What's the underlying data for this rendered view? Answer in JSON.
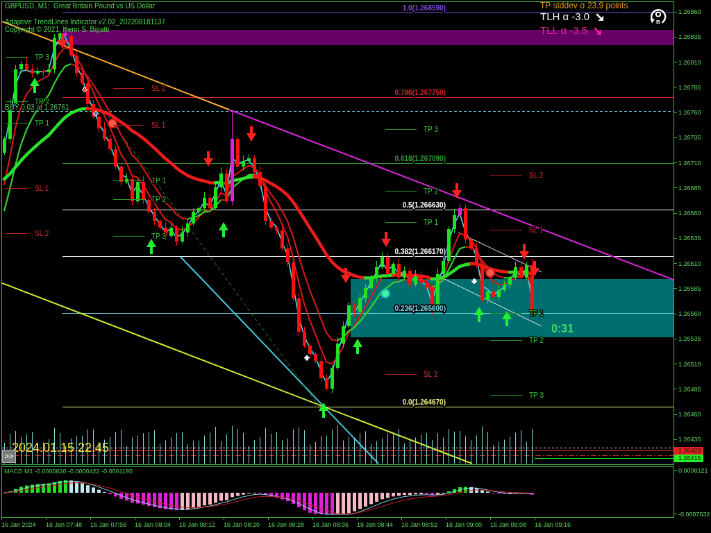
{
  "header": {
    "title": "GBPUSD, M1:  Great Britain Pound vs US Dollar",
    "indicator": "Adaptive TrendLines Indicator v2.02_202208181137",
    "copyright": "Copyright © 2021, Henri S. Bigatti"
  },
  "stddev_note": "TP stddev σ 23.9 points",
  "trend_stats": [
    {
      "label": "TLH α -3.0",
      "color": "#f0f0f0"
    },
    {
      "label": "TLL α -3.5",
      "color": "#e8209a"
    }
  ],
  "logo_letter": "B",
  "fib_levels": [
    {
      "label": "1.0(1.268590)",
      "color": "#7a4fd8"
    },
    {
      "label": "0.786(1.267750)",
      "color": "#d42424"
    },
    {
      "label": "0.618(1.267090)",
      "color": "#2f9a2f"
    },
    {
      "label": "0.5(1.266630)",
      "color": "#ffffff"
    },
    {
      "label": "0.382(1.266170)",
      "color": "#fafafa"
    },
    {
      "label": "0.236(1.265600)",
      "color": "#7fd8e8"
    },
    {
      "label": "0.0(1.264670)",
      "color": "#f0f080"
    }
  ],
  "order": {
    "label": "BUY 0.03 at 1.26761"
  },
  "signal_groups": [
    {
      "levels": [
        {
          "kind": "tp",
          "label": "TP 3"
        },
        {
          "kind": "tp",
          "label": "TP 2"
        },
        {
          "kind": "tp",
          "label": "TP 1"
        },
        {
          "kind": "sl",
          "label": "SL 1"
        },
        {
          "kind": "sl",
          "label": "SL 2"
        }
      ]
    },
    {
      "levels": [
        {
          "kind": "sl",
          "label": "SL 2"
        },
        {
          "kind": "sl",
          "label": "SL 1"
        },
        {
          "kind": "tp",
          "label": "TP 1"
        },
        {
          "kind": "tp",
          "label": "TP 2"
        },
        {
          "kind": "tp",
          "label": "TP 3"
        }
      ]
    },
    {
      "levels": [
        {
          "kind": "tp",
          "label": "TP 3"
        },
        {
          "kind": "tp",
          "label": "TP 2"
        },
        {
          "kind": "tp",
          "label": "TP 1"
        },
        {
          "kind": "sl",
          "label": "SL 2"
        }
      ]
    },
    {
      "levels": [
        {
          "kind": "sl",
          "label": "SL 2"
        },
        {
          "kind": "sl",
          "label": "SL 1"
        },
        {
          "kind": "tp",
          "label": "TP 1"
        },
        {
          "kind": "tp",
          "label": "TP 2"
        },
        {
          "kind": "tp",
          "label": "TP 3"
        }
      ]
    }
  ],
  "countdown": "0:31",
  "date_stamp": "2024.01.15 22:45",
  "scroll_button": ">>",
  "price_axis": [
    "1.26860",
    "1.26835",
    "1.26810",
    "1.26785",
    "1.26760",
    "1.26735",
    "1.26710",
    "1.26685",
    "1.26660",
    "1.26635",
    "1.26610",
    "1.26585",
    "1.26560",
    "1.26535",
    "1.26510",
    "1.26485",
    "1.26460",
    "1.26435"
  ],
  "price_tags": [
    {
      "label": "1.26423",
      "color": "#e02222"
    },
    {
      "label": "1.26416",
      "color": "#22ee22"
    }
  ],
  "macd": {
    "label": "MACD M1 -0.0000820 -0.0000422 -0.0001195",
    "axis": [
      "0.0008121",
      "-0.0007632"
    ]
  },
  "time_axis": [
    "16 Jan 2024",
    "16 Jan 07:48",
    "16 Jan 07:56",
    "16 Jan 08:04",
    "16 Jan 08:12",
    "16 Jan 08:20",
    "16 Jan 08:28",
    "16 Jan 08:36",
    "16 Jan 08:44",
    "16 Jan 08:52",
    "16 Jan 09:00",
    "16 Jan 09:08",
    "16 Jan 09:16"
  ]
}
